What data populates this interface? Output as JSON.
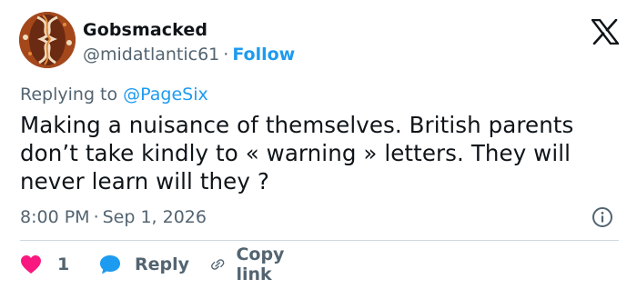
{
  "user": {
    "name": "Gobsmacked",
    "handle": "@midatlantic61",
    "separator": "·",
    "follow_label": "Follow"
  },
  "reply_to": {
    "prefix": "Replying to",
    "mention": "@PageSix"
  },
  "tweet": {
    "text": "Making a nuisance of themselves. British parents don’t take kindly to « warning » letters. They will never learn will they ?",
    "time": "8:00 PM",
    "date_separator": "·",
    "date": "Sep 1, 2026"
  },
  "actions": {
    "like_count": "1",
    "reply_label": "Reply",
    "copy_link_label": "Copy link"
  },
  "colors": {
    "like": "#f91880",
    "reply": "#1d9bf0",
    "link_blue": "#1d9bf0",
    "muted": "#536471",
    "text": "#0f1419"
  },
  "icons": {
    "platform": "x-logo-icon",
    "info": "info-icon",
    "like": "heart-icon",
    "reply": "speech-bubble-icon",
    "copy_link": "link-icon"
  }
}
